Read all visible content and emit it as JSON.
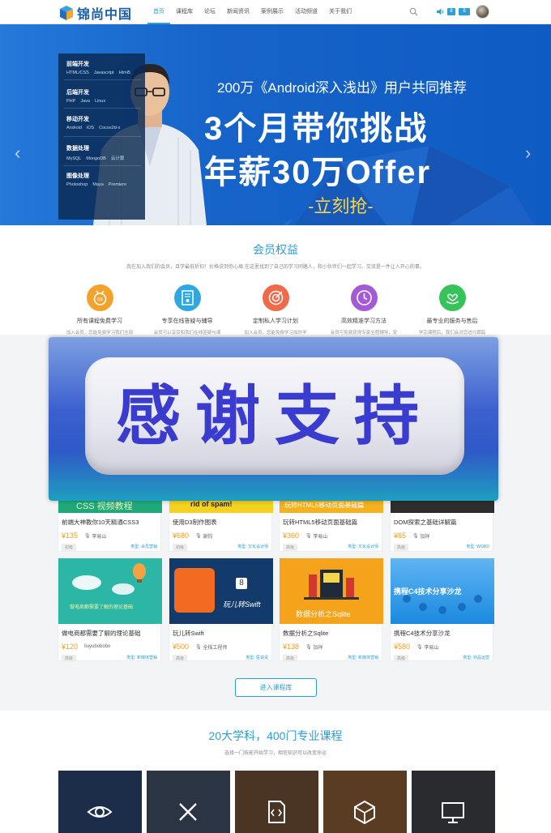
{
  "header": {
    "logo_text": "锦尚中国",
    "nav": [
      {
        "label": "首页",
        "active": true
      },
      {
        "label": "课程库"
      },
      {
        "label": "论坛"
      },
      {
        "label": "新闻资讯"
      },
      {
        "label": "案例展示"
      },
      {
        "label": "活动频道"
      },
      {
        "label": "关于我们"
      }
    ],
    "icons": {
      "search": "search-icon",
      "sound": "speaker-icon"
    },
    "msg_badge": "8",
    "user_badge": "8"
  },
  "banner": {
    "subtitle": "200万《Android深入浅出》用户共同推荐",
    "title_line1": "3个月带你挑战",
    "title_line2": "年薪30万Offer",
    "cta": "-立刻抢-",
    "slide_count": 4,
    "active_slide": 0,
    "categories": [
      {
        "title": "前端开发",
        "items": [
          "HTML/CSS",
          "Javascript",
          "Html5"
        ]
      },
      {
        "title": "后端开发",
        "items": [
          "PHP",
          "Java",
          "Linux"
        ]
      },
      {
        "title": "移动开发",
        "items": [
          "Android",
          "iOS",
          "Cocos2d-x"
        ]
      },
      {
        "title": "数据处理",
        "items": [
          "MySQL",
          "MongoDB",
          "云计算"
        ]
      },
      {
        "title": "图像处理",
        "items": [
          "Photoshop",
          "Maya",
          "Premiere"
        ]
      }
    ]
  },
  "member": {
    "title": "会员权益",
    "desc": "我在加入我们的会员，且学最低折扣！价格说到你心扉,在这里找到了自己的学习同路人，和小伙伴们一起学习。交流是一件让人开心的事。",
    "benefits": [
      {
        "label": "所有课程免费学习",
        "desc": "加入会员，您能免费学习我们全部",
        "color": "#f3a32c",
        "icon": "medal-icon"
      },
      {
        "label": "专享在线答疑与辅导",
        "desc": "会员可以享受和我们在线答疑与课",
        "color": "#2ea8e0",
        "icon": "certificate-icon"
      },
      {
        "label": "定制私人学习计划",
        "desc": "加入会员，您能免费学习加你学",
        "color": "#ee6a4a",
        "icon": "target-icon"
      },
      {
        "label": "高效精准学习方法",
        "desc": "会员可免费获得专家全程辅导，安",
        "color": "#a25ad6",
        "icon": "clock-icon"
      },
      {
        "label": "最专业的服务与售后",
        "desc": "学完课程后，我们会对您进行跟踪",
        "color": "#35c35a",
        "icon": "heart-hand-icon"
      }
    ]
  },
  "overlay": {
    "text": "感谢支持"
  },
  "courses_row1": [
    {
      "banner_text": "CSS 视频教程",
      "title": "前端大神教你10天精通CSS3",
      "price": "¥135",
      "teacher": "李易山",
      "level": "初级",
      "type": "类型: 会员营销",
      "bg": "#1fa97a"
    },
    {
      "banner_text": "rid of spam!",
      "title": "使用D3制作图表",
      "price": "¥680",
      "teacher": "谢钧",
      "level": "初级",
      "type": "类型: 文化设计师",
      "bg": "#f4d21f"
    },
    {
      "banner_text": "玩转HTML5移动页面基础篇",
      "title": "玩转HTML5移动页面基础篇",
      "price": "¥360",
      "teacher": "李易山",
      "level": "高级",
      "type": "类型: 文化设计师",
      "bg": "#f5b21d"
    },
    {
      "banner_text": "",
      "title": "DOM探索之基础详解篇",
      "price": "¥65",
      "teacher": "加祥",
      "level": "高级",
      "type": "类型: WORD",
      "bg": "#2d2d2d"
    }
  ],
  "courses_row2": [
    {
      "banner_text": "做电商都需要了解的理论基础",
      "title": "做电商都需要了解的理论基础",
      "price": "¥120",
      "teacher": "liuyubobobo",
      "level": "高级",
      "type": "类型: 新媒体营销",
      "bg": "#2bb6a6"
    },
    {
      "banner_text": "玩儿转Swift",
      "title": "玩儿转Swift",
      "price": "¥500",
      "teacher": "全栈工程师",
      "level": "高级",
      "type": "类型: 医说说",
      "bg": "#123a6a"
    },
    {
      "banner_text": "数据分析之Sqlite",
      "title": "数据分析之Sqlite",
      "price": "¥138",
      "teacher": "加祥",
      "level": "高级",
      "type": "类型: 新媒体营销",
      "bg": "#f5a31a"
    },
    {
      "banner_text": "携程C4技术分享沙龙",
      "title": "携程C4技术分享沙龙",
      "price": "¥580",
      "teacher": "李易山",
      "level": "高级",
      "type": "类型: 商品运营",
      "bg": "#1b8ae0"
    }
  ],
  "enter_button": "进入课程库",
  "section2": {
    "title": "20大学科，400门专业课程",
    "desc": "选择一门技能开始学习，相信知识可以改变命运",
    "subjects": [
      {
        "icon": "eye-icon",
        "bg": "#1b2d48"
      },
      {
        "icon": "design-tools-icon",
        "bg": "#2b3442"
      },
      {
        "icon": "code-file-icon",
        "bg": "#4a3424"
      },
      {
        "icon": "cube-icon",
        "bg": "#5a3c22"
      },
      {
        "icon": "monitor-icon",
        "bg": "#2a2b2e"
      }
    ]
  }
}
